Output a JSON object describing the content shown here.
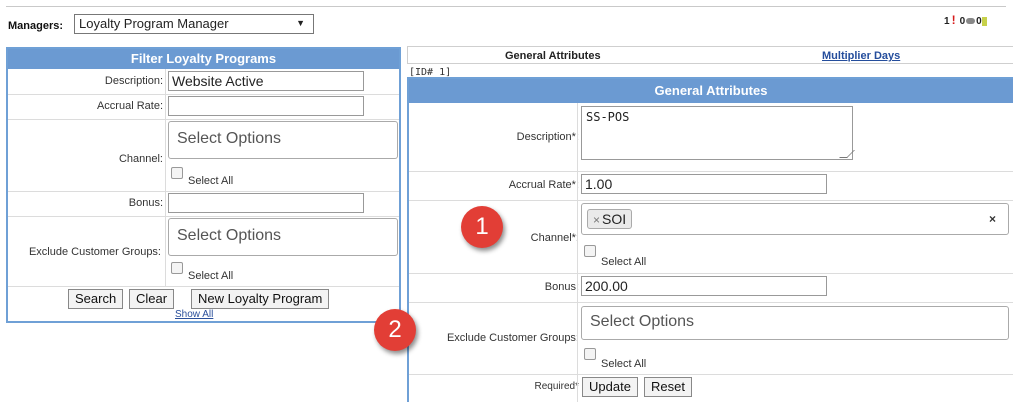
{
  "managers": {
    "label": "Managers:",
    "selected": "Loyalty Program Manager",
    "arrow": "▼"
  },
  "status": {
    "count": "1",
    "excl": "!",
    "messages": "0"
  },
  "filter": {
    "title": "Filter Loyalty Programs",
    "description_label": "Description:",
    "description_value": "Website Active",
    "accrual_label": "Accrual Rate:",
    "accrual_value": "",
    "channel_label": "Channel:",
    "channel_placeholder": "Select Options",
    "select_all": "Select All",
    "bonus_label": "Bonus:",
    "bonus_value": "",
    "exclude_label": "Exclude Customer Groups:",
    "exclude_placeholder": "Select Options",
    "search_btn": "Search",
    "clear_btn": "Clear",
    "new_btn": "New Loyalty Program",
    "show_all": "Show All"
  },
  "tabs": {
    "general": "General Attributes",
    "multiplier": "Multiplier Days"
  },
  "id_label": "[ID# 1]",
  "general": {
    "title": "General Attributes",
    "description_label": "Description*:",
    "description_value": "SS-POS",
    "accrual_label": "Accrual Rate*:",
    "accrual_value": "1.00",
    "channel_label": "Channel*:",
    "channel_tag": "SOI",
    "tag_remove": "×",
    "clear_icon": "×",
    "select_all": "Select All",
    "bonus_label": "Bonus:",
    "bonus_value": "200.00",
    "exclude_label": "Exclude Customer Groups:",
    "exclude_placeholder": "Select Options",
    "required_label": "Required*",
    "update_btn": "Update",
    "reset_btn": "Reset"
  },
  "callouts": [
    "1",
    "2"
  ],
  "colors": {
    "panel_header": "#6b9ad2",
    "panel_border": "#6fa0d6",
    "callout": "#e23e36",
    "link": "#244d9c"
  }
}
